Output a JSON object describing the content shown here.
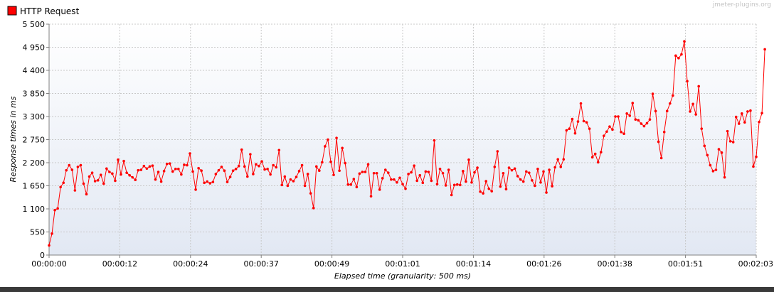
{
  "legend": {
    "label": "HTTP Request",
    "swatch_color": "#ff0000"
  },
  "watermark": "jmeter-plugins.org",
  "colors": {
    "series": "#ff0000",
    "background_top": "#ffffff",
    "background_bottom": "#e2e8f3",
    "grid": "#c8c8c8",
    "bottom_bar": "#3a3a3a"
  },
  "chart_data": {
    "type": "line",
    "xlabel": "Elapsed time (granularity: 500 ms)",
    "ylabel": "Response times in ms",
    "ylim": [
      0,
      5500
    ],
    "xlim": [
      0,
      123
    ],
    "x_unit": "seconds elapsed",
    "y_ticks": [
      {
        "value": 0,
        "label": "0"
      },
      {
        "value": 550,
        "label": "550"
      },
      {
        "value": 1100,
        "label": "1 100"
      },
      {
        "value": 1650,
        "label": "1 650"
      },
      {
        "value": 2200,
        "label": "2 200"
      },
      {
        "value": 2750,
        "label": "2 750"
      },
      {
        "value": 3300,
        "label": "3 300"
      },
      {
        "value": 3850,
        "label": "3 850"
      },
      {
        "value": 4400,
        "label": "4 400"
      },
      {
        "value": 4950,
        "label": "4 950"
      },
      {
        "value": 5500,
        "label": "5 500"
      }
    ],
    "x_ticks": [
      {
        "value": 0,
        "label": "00:00:00"
      },
      {
        "value": 12.3,
        "label": "00:00:12"
      },
      {
        "value": 24.6,
        "label": "00:00:24"
      },
      {
        "value": 36.9,
        "label": "00:00:37"
      },
      {
        "value": 49.2,
        "label": "00:00:49"
      },
      {
        "value": 61.5,
        "label": "00:01:01"
      },
      {
        "value": 73.8,
        "label": "00:01:14"
      },
      {
        "value": 86.1,
        "label": "00:01:26"
      },
      {
        "value": 98.4,
        "label": "00:01:38"
      },
      {
        "value": 110.7,
        "label": "00:01:51"
      },
      {
        "value": 123,
        "label": "00:02:03"
      }
    ],
    "grid": true,
    "series": [
      {
        "name": "HTTP Request",
        "x_start": 0,
        "x_step": 0.5,
        "values": [
          230,
          510,
          1070,
          1110,
          1620,
          1720,
          2020,
          2140,
          2030,
          1540,
          2100,
          2140,
          1700,
          1450,
          1870,
          1960,
          1760,
          1780,
          1910,
          1700,
          2060,
          1980,
          1940,
          1770,
          2270,
          1920,
          2240,
          1960,
          1900,
          1850,
          1790,
          2020,
          2030,
          2120,
          2060,
          2110,
          2130,
          1800,
          1980,
          1750,
          2000,
          2170,
          2180,
          1990,
          2050,
          2050,
          1920,
          2150,
          2140,
          2420,
          1990,
          1560,
          2070,
          2010,
          1720,
          1750,
          1710,
          1740,
          1930,
          2020,
          2100,
          2010,
          1740,
          1860,
          2010,
          2050,
          2120,
          2510,
          2110,
          1870,
          2400,
          1930,
          2160,
          2120,
          2230,
          2040,
          2050,
          1920,
          2140,
          2090,
          2500,
          1670,
          1870,
          1650,
          1800,
          1760,
          1860,
          2000,
          2140,
          1650,
          1930,
          1470,
          1120,
          2110,
          2010,
          2210,
          2590,
          2750,
          2220,
          1910,
          2790,
          2010,
          2550,
          2190,
          1680,
          1680,
          1810,
          1620,
          1940,
          1980,
          1980,
          2160,
          1400,
          1950,
          1950,
          1560,
          1830,
          2030,
          1960,
          1800,
          1800,
          1730,
          1840,
          1690,
          1580,
          1930,
          1970,
          2130,
          1770,
          1900,
          1720,
          1990,
          1980,
          1770,
          2730,
          1690,
          2050,
          1950,
          1660,
          2030,
          1430,
          1670,
          1680,
          1670,
          2000,
          1750,
          2270,
          1730,
          1970,
          2080,
          1510,
          1470,
          1760,
          1580,
          1520,
          2100,
          2470,
          1630,
          1950,
          1570,
          2080,
          2020,
          2060,
          1880,
          1800,
          1750,
          1990,
          1960,
          1780,
          1650,
          2050,
          1730,
          1990,
          1490,
          2030,
          1640,
          2090,
          2280,
          2100,
          2280,
          2970,
          3010,
          3240,
          2900,
          3180,
          3610,
          3190,
          3160,
          3010,
          2330,
          2410,
          2210,
          2450,
          2840,
          2940,
          3060,
          2990,
          3300,
          3300,
          2930,
          2890,
          3370,
          3320,
          3620,
          3230,
          3210,
          3130,
          3070,
          3140,
          3230,
          3840,
          3430,
          2700,
          2310,
          2930,
          3430,
          3610,
          3800,
          4750,
          4690,
          4780,
          5090,
          4140,
          3420,
          3600,
          3350,
          4020,
          3010,
          2600,
          2380,
          2140,
          2000,
          2030,
          2520,
          2440,
          1850,
          2950,
          2710,
          2690,
          3290,
          3130,
          3370,
          3160,
          3420,
          3440,
          2110,
          2340,
          3170,
          3380,
          4900
        ]
      }
    ]
  }
}
